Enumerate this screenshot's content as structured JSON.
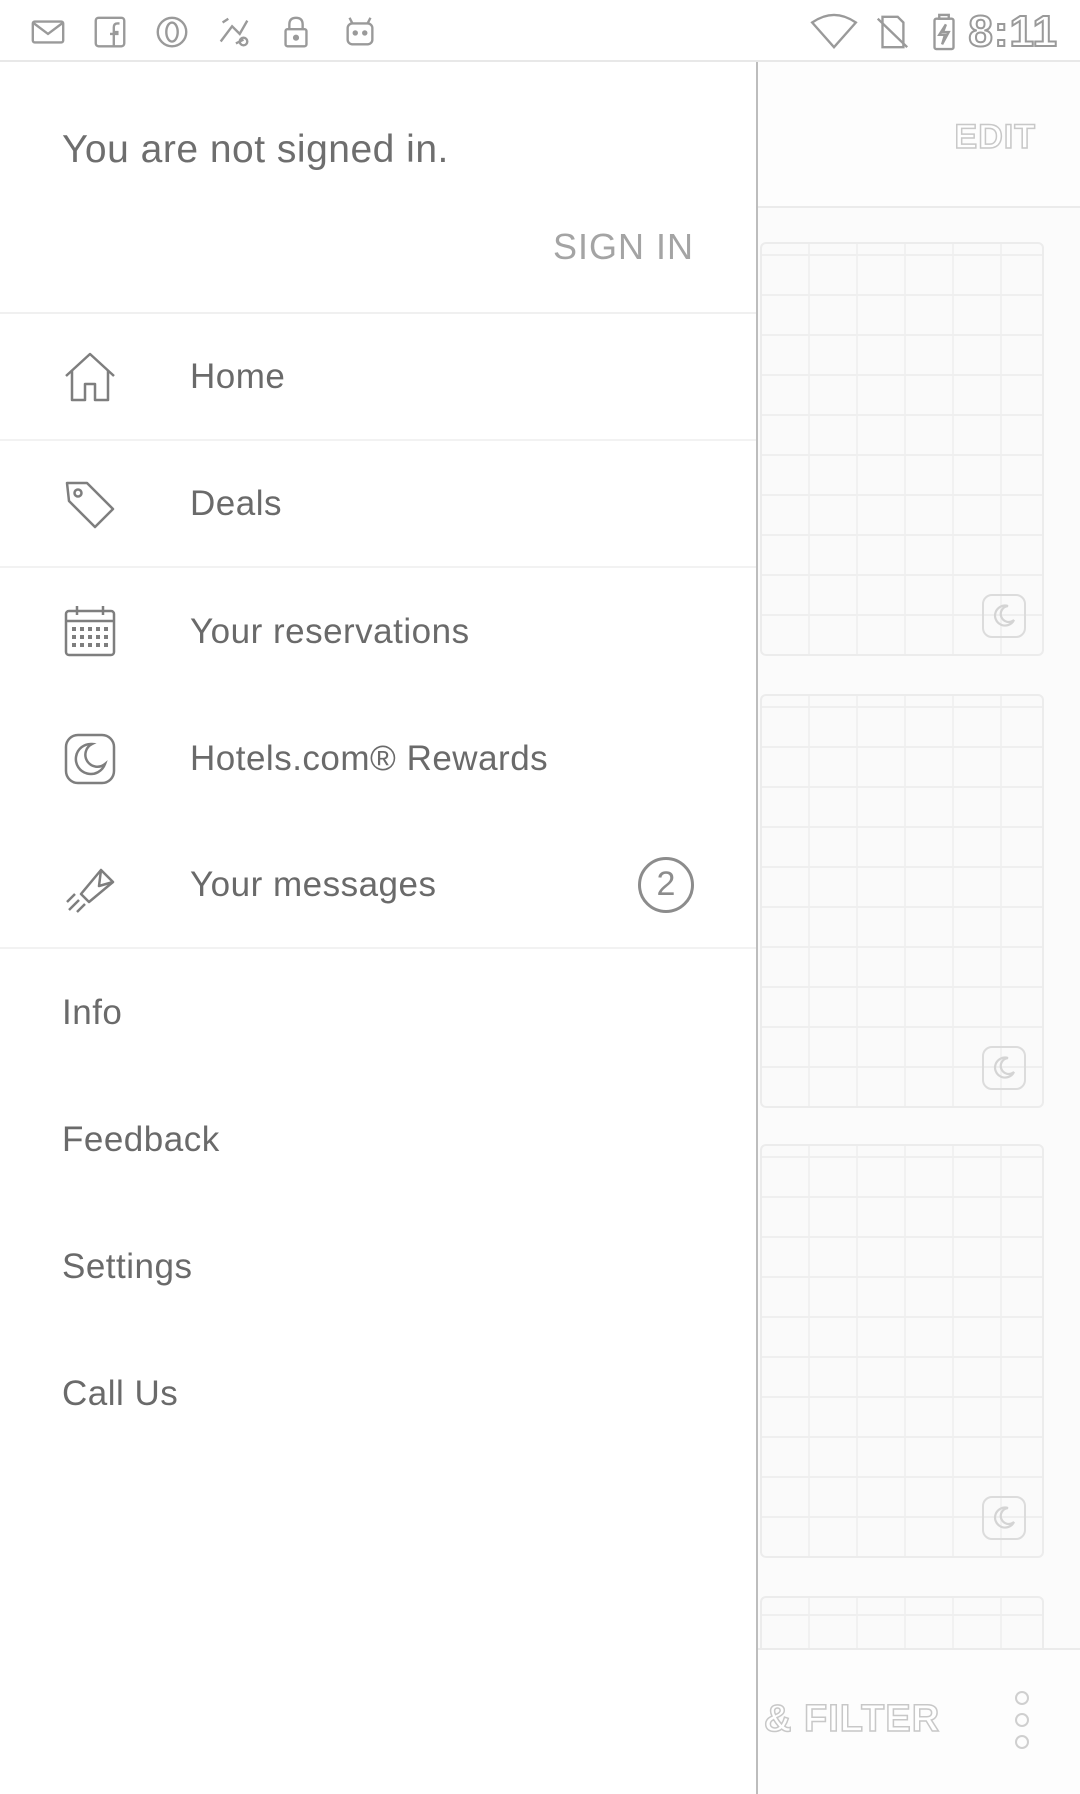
{
  "status_bar": {
    "time": "8:11",
    "notification_icons": [
      "mail-icon",
      "facebook-icon",
      "opera-icon",
      "fake-gps-icon",
      "lock-icon",
      "android-icon"
    ],
    "system_icons": [
      "wifi-icon",
      "no-sim-icon",
      "battery-charging-icon"
    ]
  },
  "drawer": {
    "header": {
      "status_text": "You are not signed in.",
      "sign_in_label": "SIGN IN"
    },
    "primary_items": [
      {
        "label": "Home",
        "icon": "home-icon"
      },
      {
        "label": "Deals",
        "icon": "tag-icon"
      },
      {
        "label": "Your reservations",
        "icon": "calendar-icon"
      },
      {
        "label": "Hotels.com® Rewards",
        "icon": "rewards-moon-icon"
      },
      {
        "label": "Your messages",
        "icon": "messages-icon",
        "badge": "2"
      }
    ],
    "secondary_items": [
      {
        "label": "Info"
      },
      {
        "label": "Feedback"
      },
      {
        "label": "Settings"
      },
      {
        "label": "Call Us"
      }
    ]
  },
  "background_screen": {
    "edit_label": "EDIT",
    "filter_label": "& FILTER"
  },
  "colors": {
    "drawer_background": "#ffffff",
    "primary_text": "#6a6a6a",
    "secondary_text": "#a4a4a4",
    "divider": "#f0f0f0"
  }
}
